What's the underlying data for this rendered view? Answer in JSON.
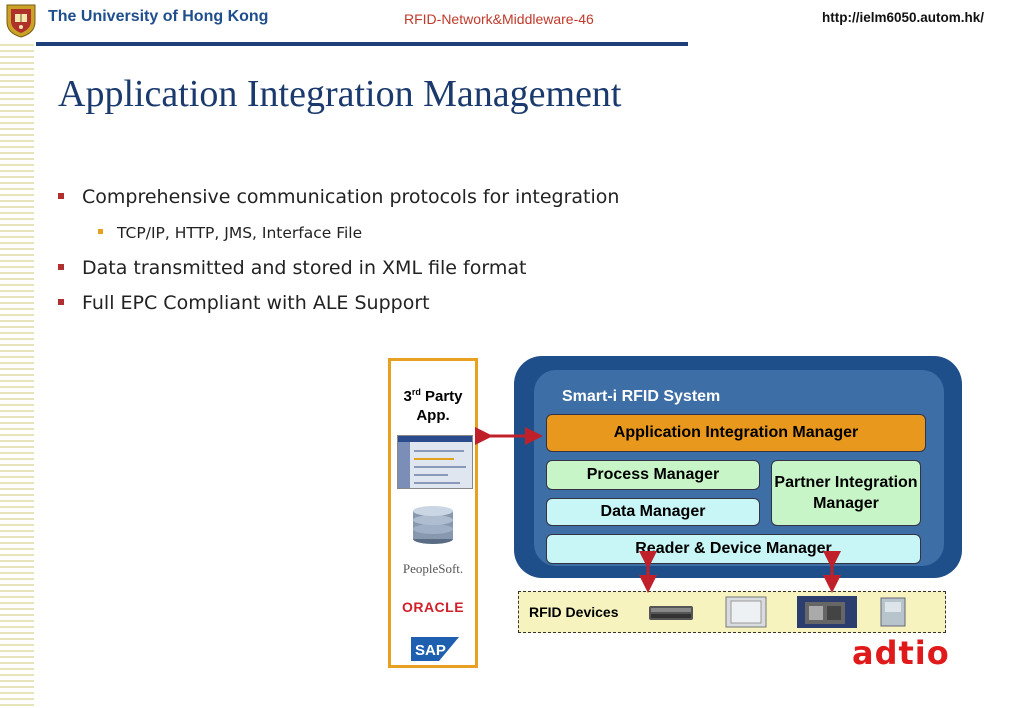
{
  "header": {
    "university": "The University of Hong Kong",
    "course": "RFID-Network&Middleware-46",
    "url": "http://ielm6050.autom.hk/"
  },
  "title": "Application Integration Management",
  "bullets": [
    {
      "text": "Comprehensive communication protocols for integration",
      "sub": [
        "TCP/IP, HTTP, JMS, Interface File"
      ]
    },
    {
      "text": "Data transmitted and stored in XML file format",
      "sub": []
    },
    {
      "text": "Full EPC Compliant with ALE Support",
      "sub": []
    }
  ],
  "diagram": {
    "third_party": {
      "title_line1": "3",
      "title_sup": "rd",
      "title_rest": " Party",
      "title_line2": "App."
    },
    "logos": {
      "peoplesoft": "PeopleSoft.",
      "oracle": "ORACLE",
      "sap": "SAP"
    },
    "system_label": "Smart-i RFID System",
    "managers": {
      "application_integration": "Application Integration Manager",
      "process": "Process Manager",
      "partner_integration": "Partner Integration Manager",
      "data": "Data Manager",
      "reader_device": "Reader & Device Manager"
    },
    "devices_label": "RFID Devices",
    "brand": "adtio"
  },
  "colors": {
    "title_blue": "#1a3a6e",
    "header_rule": "#1f3f7a",
    "bullet_red": "#b03030",
    "sub_bullet_orange": "#e8a020",
    "system_blue": "#1f4f8a",
    "aim_orange": "#e8981c",
    "green_manager": "#c8f5c8",
    "cyan_manager": "#c8f5f5",
    "arrow_red": "#c0202a",
    "brand_red": "#e01a1a"
  }
}
